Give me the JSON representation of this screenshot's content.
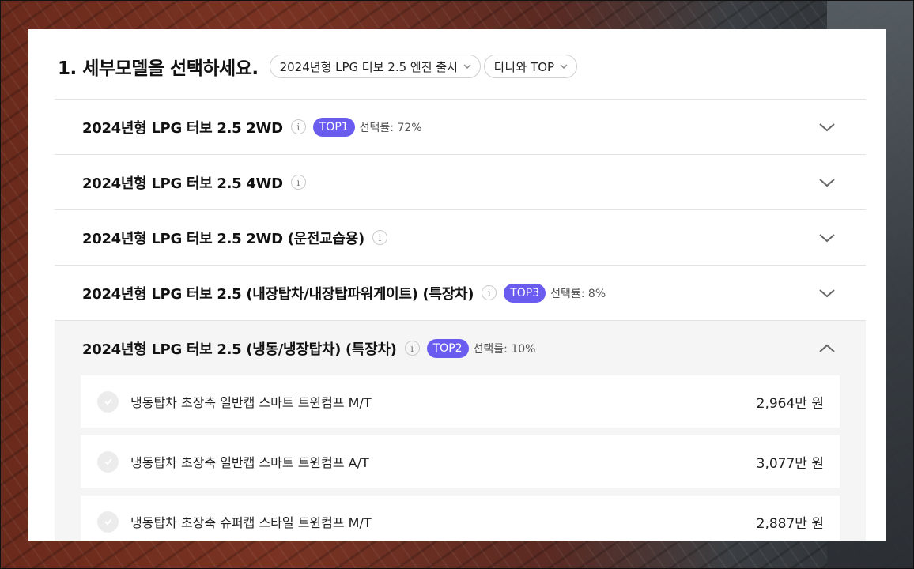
{
  "header": {
    "title": "1. 세부모델을 선택하세요.",
    "filter_label": "2024년형 LPG 터보 2.5 엔진 출시",
    "sort_label": "다나와 TOP"
  },
  "models": [
    {
      "title": "2024년형 LPG 터보 2.5 2WD",
      "badge": "TOP1",
      "rate": "선택률: 72%"
    },
    {
      "title": "2024년형 LPG 터보 2.5 4WD"
    },
    {
      "title": "2024년형 LPG 터보 2.5 2WD (운전교습용)"
    },
    {
      "title": "2024년형 LPG 터보 2.5 (내장탑차/내장탑파워게이트) (특장차)",
      "badge": "TOP3",
      "rate": "선택률: 8%"
    },
    {
      "title": "2024년형 LPG 터보 2.5 (냉동/냉장탑차) (특장차)",
      "badge": "TOP2",
      "rate": "선택률: 10%",
      "expanded": true
    }
  ],
  "trims": [
    {
      "name": "냉동탑차 초장축 일반캡 스마트 트윈컴프 M/T",
      "price": "2,964만 원"
    },
    {
      "name": "냉동탑차 초장축 일반캡 스마트 트윈컴프 A/T",
      "price": "3,077만 원"
    },
    {
      "name": "냉동탑차 초장축 슈퍼캡 스타일 트윈컴프 M/T",
      "price": "2,887만 원"
    }
  ],
  "icons": {
    "info": "info-icon",
    "chevron_down": "chevron-down-icon",
    "chevron_up": "chevron-up-icon",
    "check": "check-icon"
  },
  "colors": {
    "badge": "#6b5cf0"
  }
}
